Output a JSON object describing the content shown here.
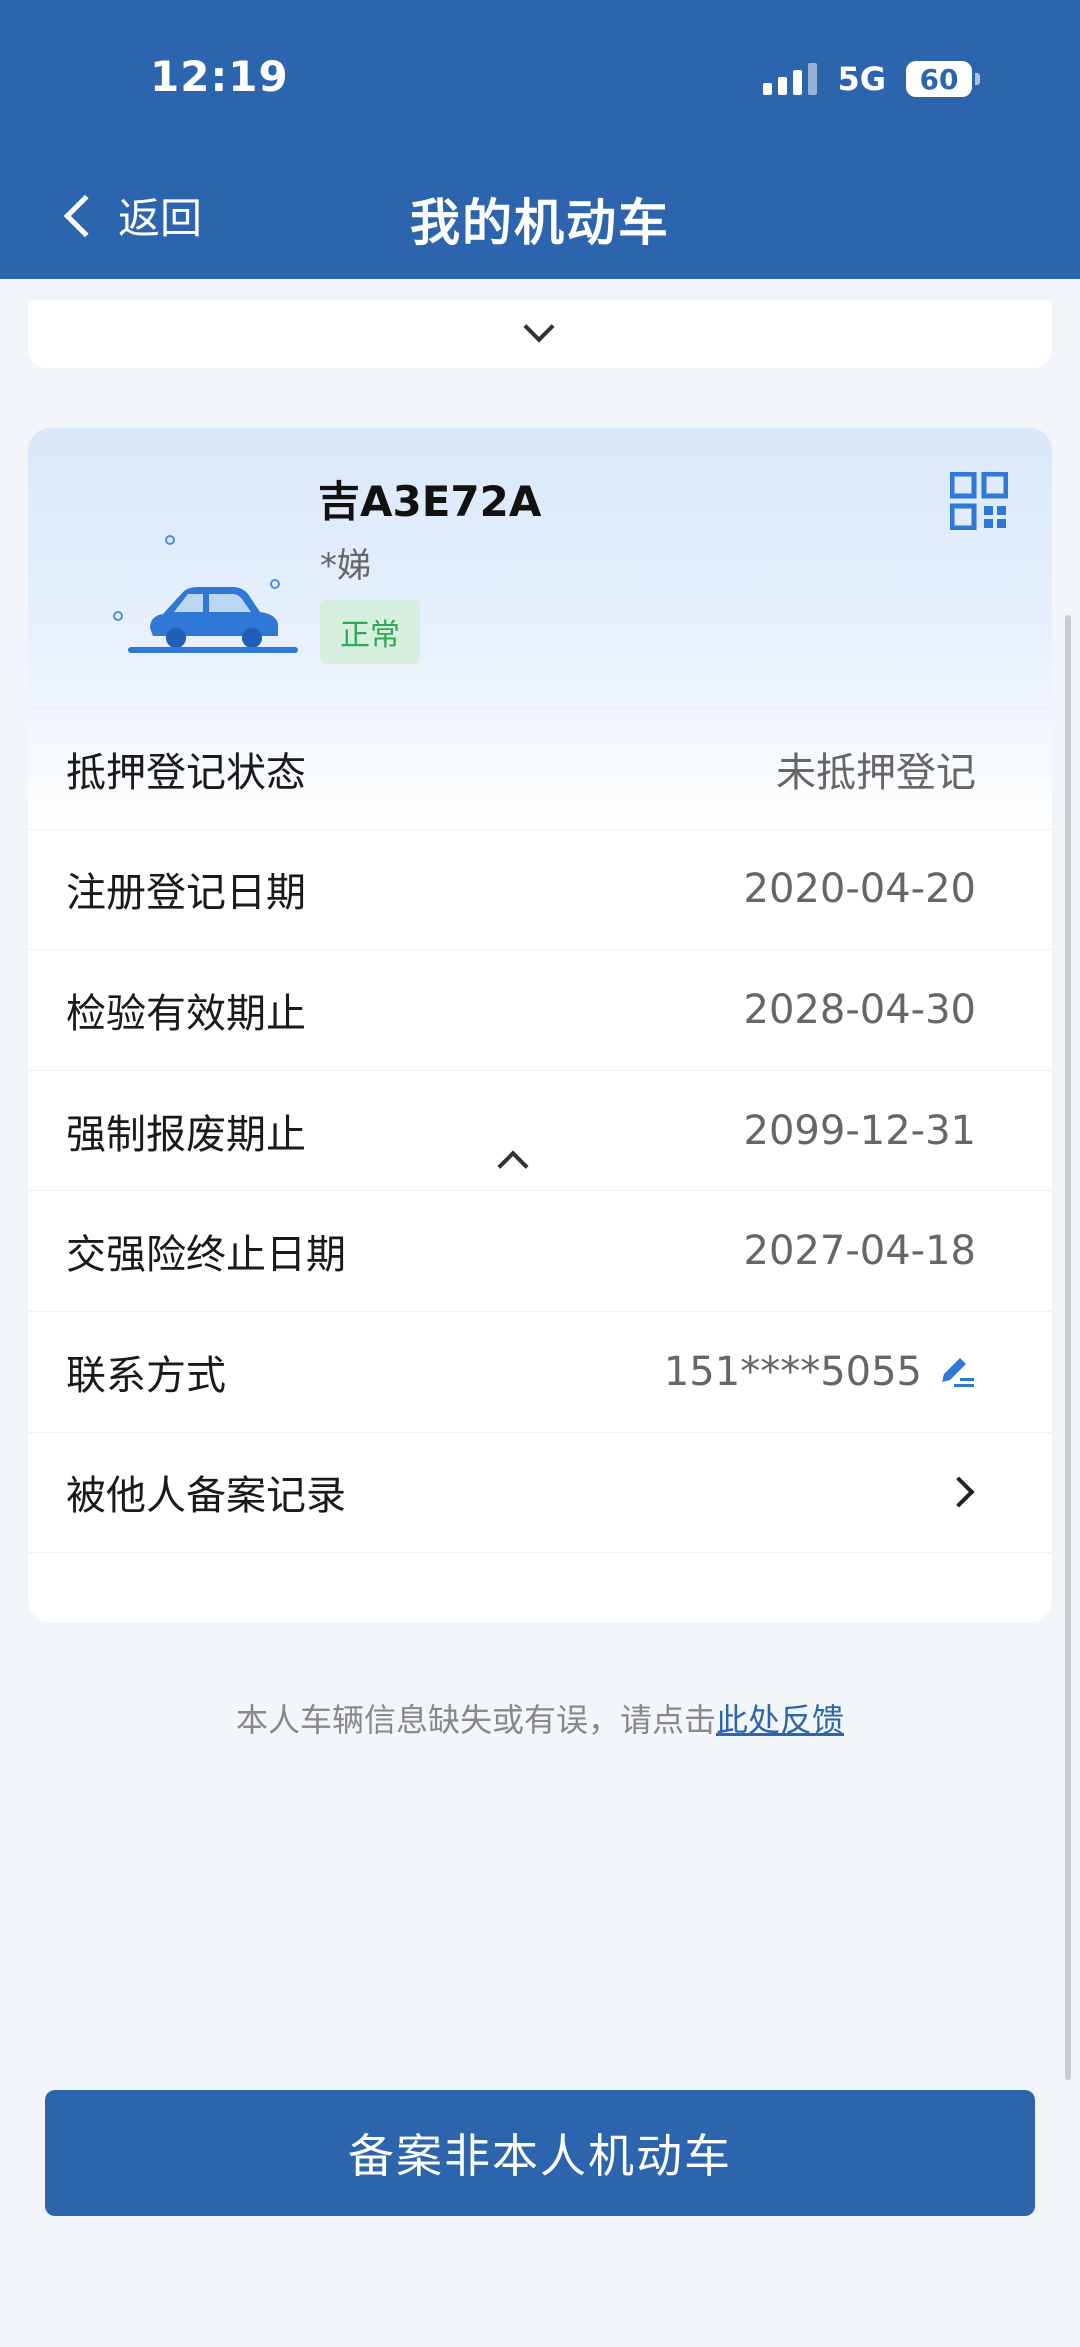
{
  "status_bar": {
    "time": "12:19",
    "network": "5G",
    "battery": "60"
  },
  "header": {
    "back_label": "返回",
    "title": "我的机动车"
  },
  "vehicle": {
    "plate": "吉A3E72A",
    "owner": "*娣",
    "status": "正常"
  },
  "rows": [
    {
      "label": "抵押登记状态",
      "value": "未抵押登记"
    },
    {
      "label": "注册登记日期",
      "value": "2020-04-20"
    },
    {
      "label": "检验有效期止",
      "value": "2028-04-30"
    },
    {
      "label": "强制报废期止",
      "value": "2099-12-31"
    },
    {
      "label": "交强险终止日期",
      "value": "2027-04-18"
    },
    {
      "label": "联系方式",
      "value": "151****5055"
    },
    {
      "label": "被他人备案记录",
      "value": ""
    }
  ],
  "feedback": {
    "text": "本人车辆信息缺失或有误，请点击",
    "link": "此处反馈"
  },
  "bottom_button": "备案非本人机动车",
  "colors": {
    "header": "#2c65ae",
    "status_badge_bg": "#d7efdf",
    "status_badge_text": "#2daa57",
    "accent": "#2c65ae"
  }
}
